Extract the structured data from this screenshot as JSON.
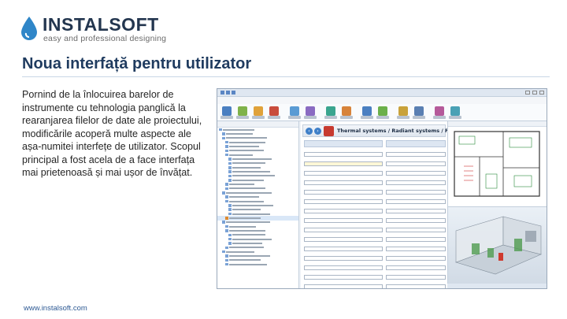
{
  "brand": {
    "name": "INSTALSOFT",
    "tagline": "easy and professional designing",
    "color": "#23364f",
    "drop_color": "#2f86c8"
  },
  "slide": {
    "title": "Noua interfață pentru utilizator",
    "body": "Pornind de la înlocuirea barelor de instrumente cu tehnologia panglică la rearanjarea filelor de date ale proiectului, modificările acoperă multe aspecte ale așa-numitei interfețe de utilizator. Scopul principal a fost acela de a face interfața mai prietenoasă și mai ușor de învățat.",
    "footer_url": "www.instalsoft.com",
    "title_color": "#1f3b5f",
    "link_color": "#2e5a94"
  },
  "app": {
    "banner_title": "Thermal systems / Radiant systems / Floor systems",
    "nav_back": "‹",
    "nav_forward": "›",
    "window_controls": [
      "minimize-icon",
      "maximize-icon",
      "close-icon"
    ],
    "accent_color": "#3e7fc8"
  }
}
